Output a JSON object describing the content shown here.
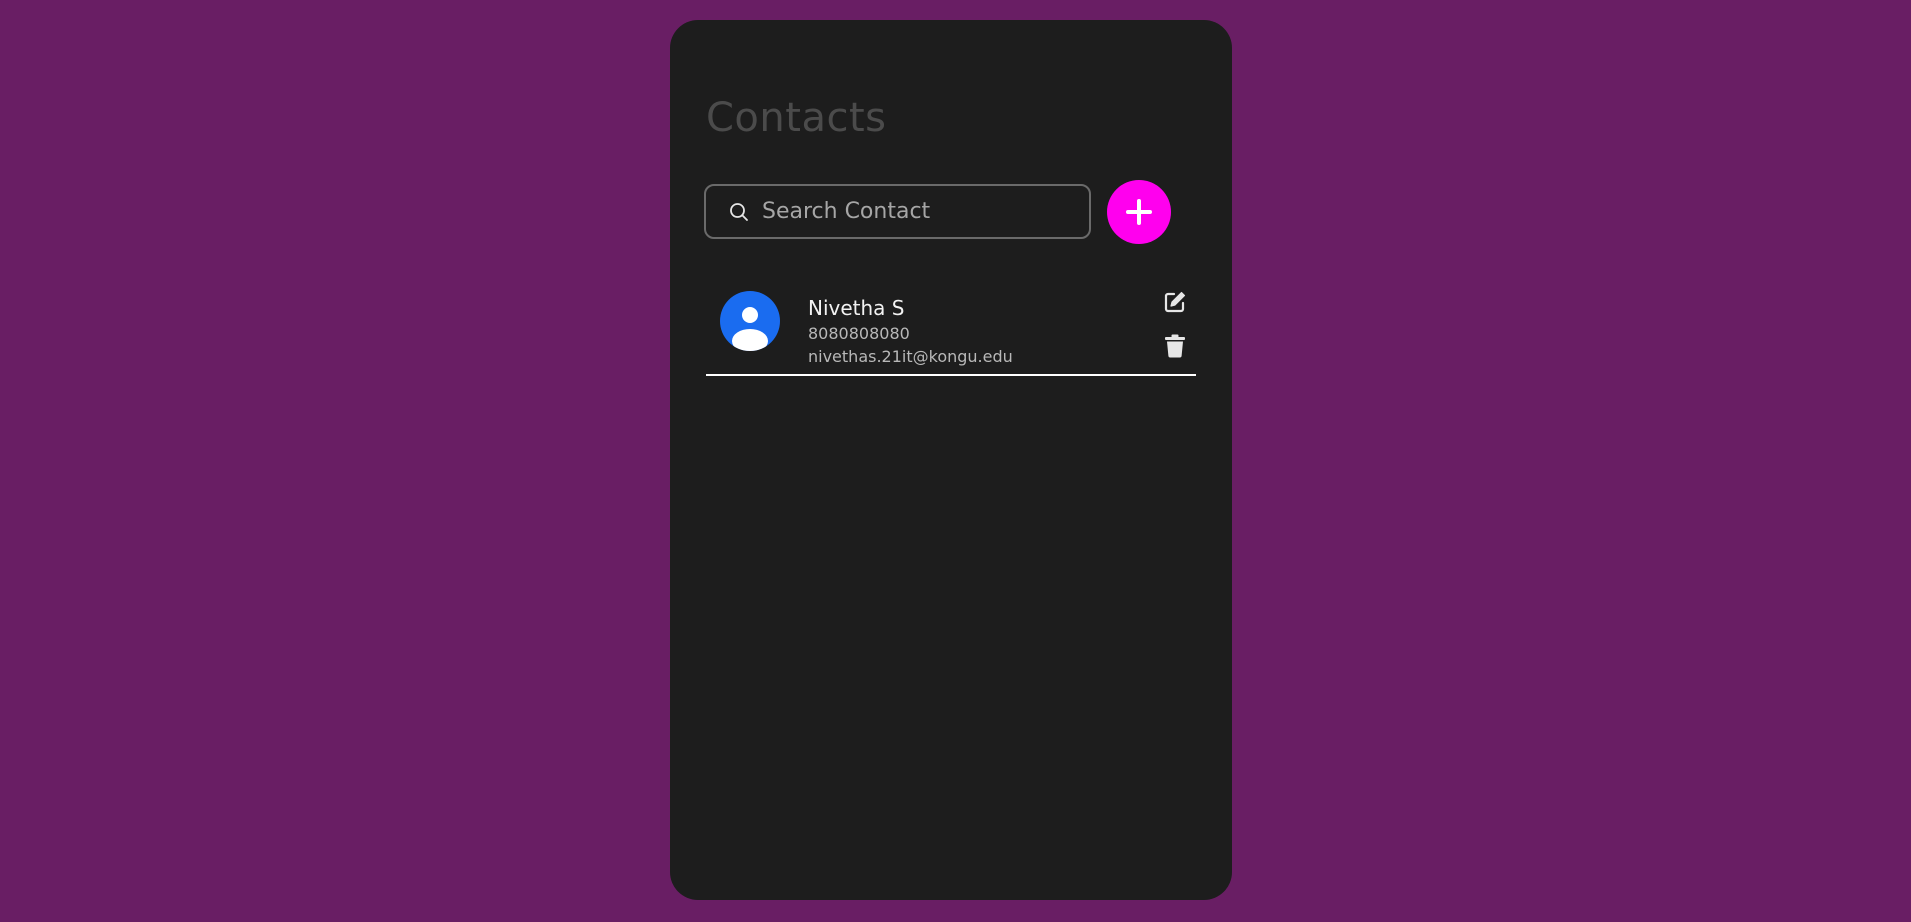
{
  "page": {
    "background_color": "#691e64",
    "card_color": "#1d1d1d",
    "accent_color": "#ff00ee"
  },
  "header": {
    "title": "Contacts"
  },
  "search": {
    "placeholder": "Search Contact",
    "value": "",
    "icon": "search-icon"
  },
  "add_button": {
    "icon": "plus-icon"
  },
  "contacts": [
    {
      "name": "Nivetha S",
      "phone": "8080808080",
      "email": "nivethas.21it@kongu.edu",
      "avatar_color": "#1a6cf0",
      "edit_icon": "edit-icon",
      "delete_icon": "trash-icon"
    }
  ]
}
